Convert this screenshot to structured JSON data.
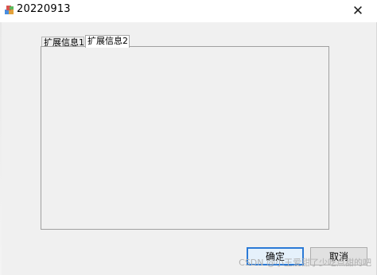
{
  "window": {
    "title": "20220913"
  },
  "titlebar": {
    "close_glyph": "✕",
    "icon": "app-icon"
  },
  "tabs": [
    {
      "label": "扩展信息1"
    },
    {
      "label": "扩展信息2"
    }
  ],
  "buttons": {
    "ok_label": "确定",
    "cancel_label": "取消"
  },
  "watermark": "CSDN @小王爱甜了少吃点甜的吧",
  "colors": {
    "focus_border": "#2b7ad6",
    "panel_bg": "#f0f0f0"
  }
}
